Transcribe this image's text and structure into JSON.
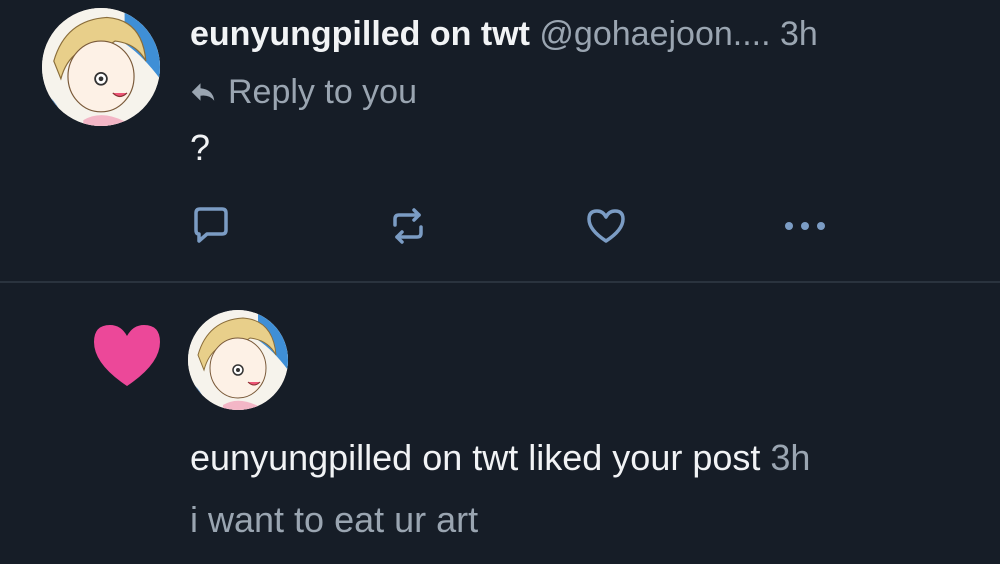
{
  "reply_notification": {
    "author_name": "eunyungpilled on twt",
    "handle": "@gohaejoon....",
    "time": "3h",
    "reply_label": "Reply to you",
    "text": "?",
    "actions": {
      "reply_icon": "comment-icon",
      "repost_icon": "repost-icon",
      "like_icon": "heart-outline-icon",
      "more_icon": "ellipsis-icon"
    }
  },
  "like_notification": {
    "icon": "heart-filled-icon",
    "icon_color": "#ec4899",
    "actor_name": "eunyungpilled on twt",
    "action_text": " liked your post ",
    "time": "3h",
    "post_text": "i want to eat ur art"
  },
  "colors": {
    "background": "#161d27",
    "primary_text": "#f1f3f5",
    "secondary_text": "#9aa5b1",
    "icon": "#7b9cc4",
    "divider": "#2a333e"
  }
}
